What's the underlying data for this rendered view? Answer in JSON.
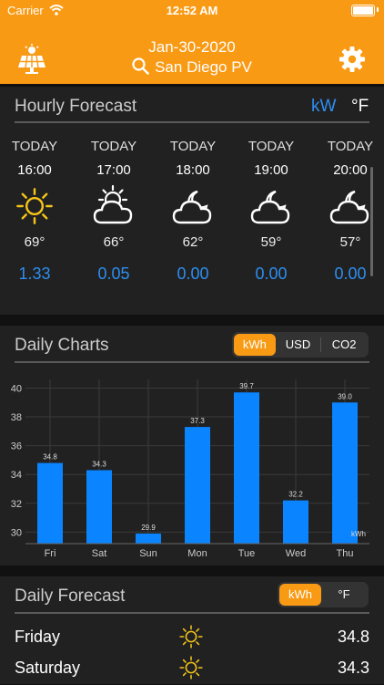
{
  "status": {
    "carrier": "Carrier",
    "time": "12:52 AM"
  },
  "header": {
    "date": "Jan-30-2020",
    "location": "San Diego PV"
  },
  "hourly": {
    "title": "Hourly Forecast",
    "unit_power": "kW",
    "unit_temp": "°F",
    "items": [
      {
        "day": "TODAY",
        "hour": "16:00",
        "icon": "sun",
        "temp": "69°",
        "value": "1.33"
      },
      {
        "day": "TODAY",
        "hour": "17:00",
        "icon": "partly-cloudy-day",
        "temp": "66°",
        "value": "0.05"
      },
      {
        "day": "TODAY",
        "hour": "18:00",
        "icon": "partly-cloudy-night",
        "temp": "62°",
        "value": "0.00"
      },
      {
        "day": "TODAY",
        "hour": "19:00",
        "icon": "partly-cloudy-night",
        "temp": "59°",
        "value": "0.00"
      },
      {
        "day": "TODAY",
        "hour": "20:00",
        "icon": "partly-cloudy-night",
        "temp": "57°",
        "value": "0.00"
      }
    ]
  },
  "daily_charts": {
    "title": "Daily Charts",
    "options": [
      "kWh",
      "USD",
      "CO2"
    ],
    "selected": "kWh"
  },
  "chart_data": {
    "type": "bar",
    "categories": [
      "Fri",
      "Sat",
      "Sun",
      "Mon",
      "Tue",
      "Wed",
      "Thu"
    ],
    "values": [
      34.8,
      34.3,
      29.9,
      37.3,
      39.7,
      32.2,
      39.0
    ],
    "value_labels": [
      "34.8",
      "34.3",
      "29.9",
      "37.3",
      "39.7",
      "32.2",
      "39.0"
    ],
    "yticks": [
      "30",
      "32",
      "34",
      "36",
      "38",
      "40"
    ],
    "ylim": [
      29.2,
      40.6
    ],
    "unit_label": "kWh",
    "grid": true,
    "color": "#0a84ff"
  },
  "daily_forecast": {
    "title": "Daily Forecast",
    "options": [
      "kWh",
      "°F"
    ],
    "selected": "kWh",
    "rows": [
      {
        "day": "Friday",
        "icon": "sun",
        "value": "34.8"
      },
      {
        "day": "Saturday",
        "icon": "sun",
        "value": "34.3"
      }
    ]
  },
  "colors": {
    "accent": "#f99a14",
    "blue": "#2d8ef0",
    "sun": "#f5c518"
  }
}
